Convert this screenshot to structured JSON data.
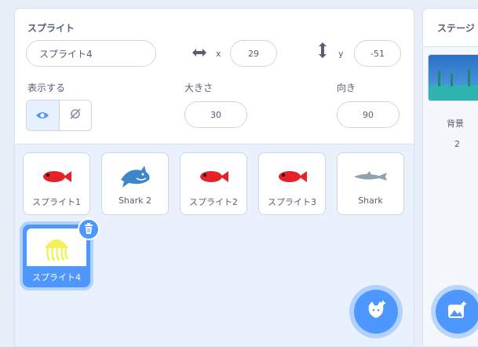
{
  "sprite_info": {
    "sprite_label": "スプライト",
    "sprite_name": "スプライト4",
    "x_label": "x",
    "x_value": "29",
    "y_label": "y",
    "y_value": "-51",
    "show_label": "表示する",
    "size_label": "大きさ",
    "size_value": "30",
    "direction_label": "向き",
    "direction_value": "90"
  },
  "sprites": [
    {
      "name": "スプライト1",
      "icon": "red-fish-icon"
    },
    {
      "name": "Shark 2",
      "icon": "blue-shark-icon"
    },
    {
      "name": "スプライト2",
      "icon": "red-fish-icon"
    },
    {
      "name": "スプライト3",
      "icon": "red-fish-icon"
    },
    {
      "name": "Shark",
      "icon": "gray-shark-icon"
    },
    {
      "name": "スプライト4",
      "icon": "yellow-jellyfish-icon",
      "selected": true
    }
  ],
  "stage": {
    "title": "ステージ",
    "backdrop_label": "背景",
    "backdrop_count": "2"
  },
  "colors": {
    "accent": "#4d97ff",
    "fish": "#e8202a",
    "jellyfish": "#f5ef5a"
  }
}
